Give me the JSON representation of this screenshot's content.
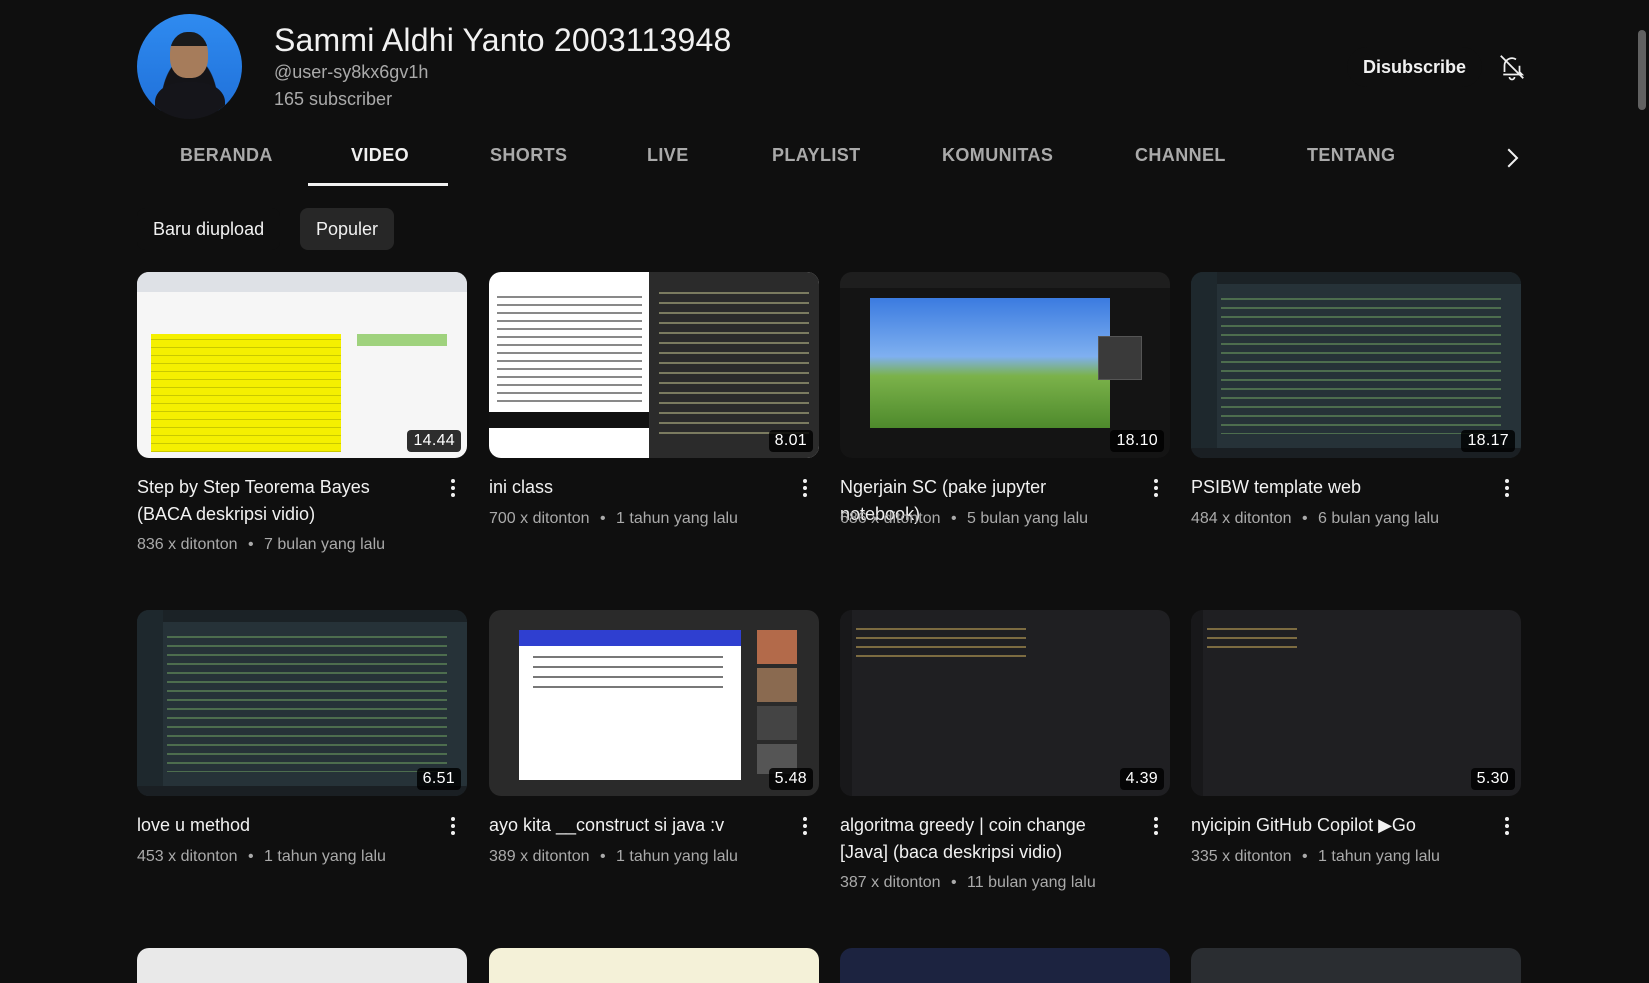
{
  "channel": {
    "name": "Sammi Aldhi Yanto 2003113948",
    "handle": "@user-sy8kx6gv1h",
    "subscribers": "165 subscriber",
    "unsubscribe_label": "Disubscribe"
  },
  "tabs": [
    {
      "label": "BERANDA"
    },
    {
      "label": "VIDEO"
    },
    {
      "label": "SHORTS"
    },
    {
      "label": "LIVE"
    },
    {
      "label": "PLAYLIST"
    },
    {
      "label": "KOMUNITAS"
    },
    {
      "label": "CHANNEL"
    },
    {
      "label": "TENTANG"
    }
  ],
  "chips": [
    {
      "label": "Baru diupload"
    },
    {
      "label": "Populer"
    }
  ],
  "videos": [
    {
      "title": "Step by Step Teorema Bayes (BACA deskripsi vidio)",
      "duration": "14.44",
      "views": "836 x ditonton",
      "age": "7 bulan yang lalu"
    },
    {
      "title": "ini class",
      "duration": "8.01",
      "views": "700 x ditonton",
      "age": "1 tahun yang lalu"
    },
    {
      "title": "Ngerjain SC (pake jupyter notebook)",
      "duration": "18.10",
      "views": "686 x ditonton",
      "age": "5 bulan yang lalu"
    },
    {
      "title": "PSIBW template web",
      "duration": "18.17",
      "views": "484 x ditonton",
      "age": "6 bulan yang lalu"
    },
    {
      "title": "love u method",
      "duration": "6.51",
      "views": "453 x ditonton",
      "age": "1 tahun yang lalu"
    },
    {
      "title": "ayo kita __construct si java :v",
      "duration": "5.48",
      "views": "389 x ditonton",
      "age": "1 tahun yang lalu"
    },
    {
      "title": "algoritma greedy | coin change [Java] (baca deskripsi vidio)",
      "duration": "4.39",
      "views": "387 x ditonton",
      "age": "11 bulan yang lalu"
    },
    {
      "title": "nyicipin GitHub Copilot ▶Go",
      "duration": "5.30",
      "views": "335 x ditonton",
      "age": "1 tahun yang lalu"
    }
  ],
  "meta_separator": "•",
  "colors": {
    "background": "#0f0f0f",
    "text_primary": "#f1f1f1",
    "text_secondary": "#aaaaaa",
    "chip_active": "#272727"
  },
  "icons": {
    "bell": "bell-off-icon",
    "more": "kebab-menu-icon",
    "tabs_next": "chevron-right-icon"
  }
}
